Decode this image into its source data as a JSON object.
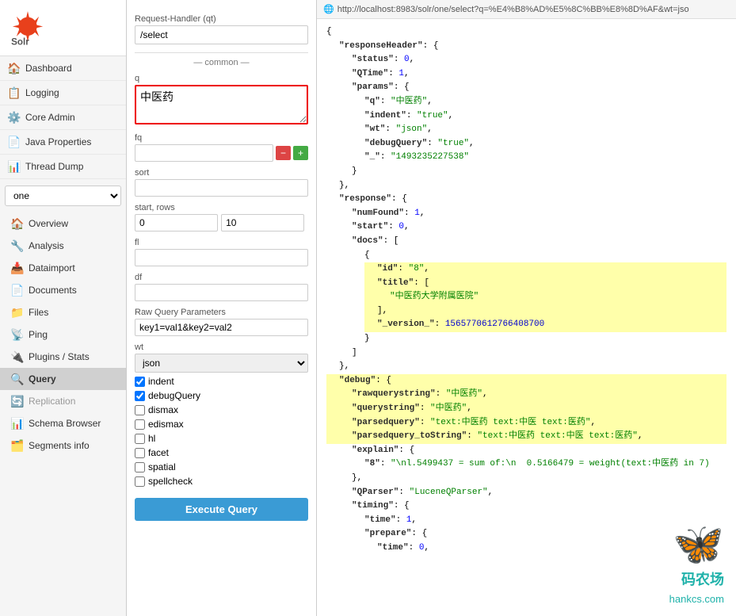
{
  "logo": {
    "alt": "Solr"
  },
  "nav": {
    "items": [
      {
        "id": "dashboard",
        "label": "Dashboard",
        "icon": "🏠"
      },
      {
        "id": "logging",
        "label": "Logging",
        "icon": "📋"
      },
      {
        "id": "core-admin",
        "label": "Core Admin",
        "icon": "⚙️"
      },
      {
        "id": "java-properties",
        "label": "Java Properties",
        "icon": "📄"
      },
      {
        "id": "thread-dump",
        "label": "Thread Dump",
        "icon": "📊"
      }
    ]
  },
  "core_selector": {
    "value": "one",
    "options": [
      "one"
    ]
  },
  "core_nav": [
    {
      "id": "overview",
      "label": "Overview",
      "icon": "🏠"
    },
    {
      "id": "analysis",
      "label": "Analysis",
      "icon": "🔧"
    },
    {
      "id": "dataimport",
      "label": "Dataimport",
      "icon": "📥"
    },
    {
      "id": "documents",
      "label": "Documents",
      "icon": "📄"
    },
    {
      "id": "files",
      "label": "Files",
      "icon": "📁"
    },
    {
      "id": "ping",
      "label": "Ping",
      "icon": "📡"
    },
    {
      "id": "plugins-stats",
      "label": "Plugins / Stats",
      "icon": "🔌"
    },
    {
      "id": "query",
      "label": "Query",
      "icon": "🔍",
      "active": true
    },
    {
      "id": "replication",
      "label": "Replication",
      "icon": "🔄",
      "disabled": true
    },
    {
      "id": "schema-browser",
      "label": "Schema Browser",
      "icon": "📊"
    },
    {
      "id": "segments-info",
      "label": "Segments info",
      "icon": "🗂️"
    }
  ],
  "form": {
    "handler_label": "Request-Handler (qt)",
    "handler_value": "/select",
    "common_label": "— common —",
    "q_label": "q",
    "q_value": "中医药",
    "fq_label": "fq",
    "fq_value": "",
    "sort_label": "sort",
    "sort_value": "",
    "start_rows_label": "start, rows",
    "start_value": "0",
    "rows_value": "10",
    "fl_label": "fl",
    "fl_value": "",
    "df_label": "df",
    "df_value": "",
    "raw_query_label": "Raw Query Parameters",
    "raw_query_value": "key1=val1&key2=val2",
    "wt_label": "wt",
    "wt_value": "json",
    "indent_label": "indent",
    "indent_checked": true,
    "debug_label": "debugQuery",
    "debug_checked": true,
    "dismax_label": "dismax",
    "edismax_label": "edismax",
    "hl_label": "hl",
    "facet_label": "facet",
    "spatial_label": "spatial",
    "spellcheck_label": "spellcheck",
    "execute_label": "Execute Query",
    "btn_minus": "−",
    "btn_plus": "+"
  },
  "url_bar": {
    "icon": "🌐",
    "url": "http://localhost:8983/solr/one/select?q=%E4%B8%AD%E5%8C%BB%E8%8D%AF&wt=jso"
  },
  "json_output": {
    "raw": "{\n  \"responseHeader\": {\n    \"status\": 0,\n    \"QTime\": 1,\n    \"params\": {\n      \"q\": \"中医药\",\n      \"indent\": \"true\",\n      \"wt\": \"json\",\n      \"debugQuery\": \"true\",\n      \"_\": \"1493235227538\"\n    }\n  },\n  \"response\": {\n    \"numFound\": 1,\n    \"start\": 0,\n    \"docs\": [\n      {\n        \"id\": \"8\",\n        \"title\": [\n          \"中医药大学附属医院\"\n        ],\n        \"_version_\": 1565770612766408700\n      }\n    ]\n  },\n  \"debug\": {\n    \"rawquerystring\": \"中医药\",\n    \"querystring\": \"中医药\",\n    \"parsedquery\": \"text:中医药 text:中医 text:医药\",\n    \"parsedquery_toString\": \"text:中医药 text:中医 text:医药\",\n    \"explain\": {\n      \"8\": \"\\nl.5499437 = sum of:\\n  0.5166479 = weight(text:中医药 in 7)\"\n    },\n    \"QParser\": \"LuceneQParser\",\n    \"timing\": {\n      \"time\": 1,\n      \"prepare\": {\n        \"time\": 0,\n      }\n    }\n  }\n}"
  },
  "watermark": {
    "site": "hankcs.com",
    "label": "码农场"
  }
}
